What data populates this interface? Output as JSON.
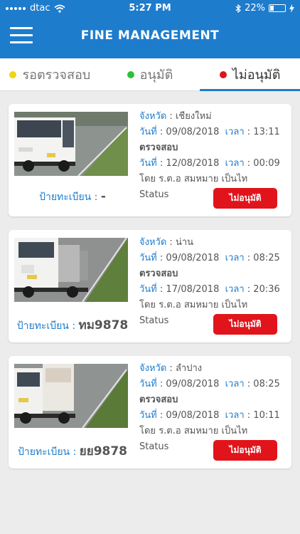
{
  "status_bar": {
    "carrier": "dtac",
    "time": "5:27 PM",
    "battery": "22%"
  },
  "nav": {
    "title": "FINE MANAGEMENT"
  },
  "tabs": [
    {
      "label": "รอตรวจสอบ",
      "dot_color": "#f1d312"
    },
    {
      "label": "อนุมัติ",
      "dot_color": "#2cc13a"
    },
    {
      "label": "ไม่อนุมัติ",
      "dot_color": "#e2141b",
      "active": true
    }
  ],
  "labels": {
    "province": "จังหวัด",
    "date": "วันที่",
    "time": "เวลา",
    "checked": "ตรวจสอบ",
    "by": "โดย",
    "status": "Status",
    "plate": "ป้ายทะเบียน"
  },
  "cards": [
    {
      "province": "เชียงใหม่",
      "date": "09/08/2018",
      "time": "13:11",
      "check_date": "12/08/2018",
      "check_time": "00:09",
      "by": "ร.ต.อ สมหมาย เป็นไท",
      "plate": "-",
      "status_button": "ไม่อนุมัติ",
      "photo": "bus"
    },
    {
      "province": "น่าน",
      "date": "09/08/2018",
      "time": "08:25",
      "check_date": "17/08/2018",
      "check_time": "20:36",
      "by": "ร.ต.อ สมหมาย เป็นไท",
      "plate": "ทม9878",
      "status_button": "ไม่อนุมัติ",
      "photo": "truck"
    },
    {
      "province": "ลำปาง",
      "date": "09/08/2018",
      "time": "08:25",
      "check_date": "09/08/2018",
      "check_time": "10:11",
      "by": "ร.ต.อ สมหมาย เป็นไท",
      "plate": "ยย9878",
      "status_button": "ไม่อนุมัติ",
      "photo": "box-truck"
    }
  ]
}
